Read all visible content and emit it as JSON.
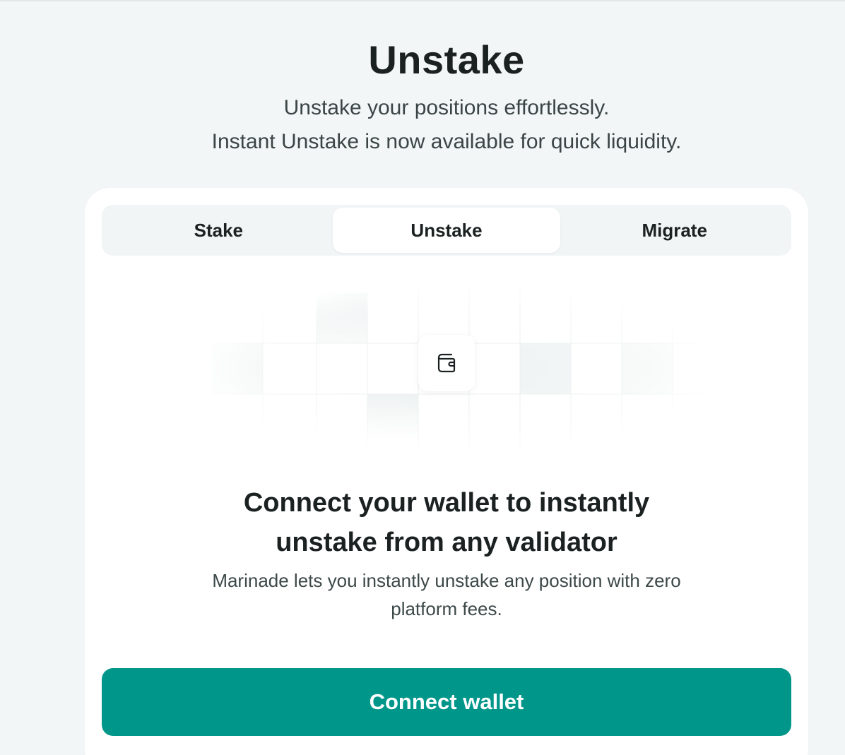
{
  "header": {
    "title": "Unstake",
    "subtitle_line1": "Unstake your positions effortlessly.",
    "subtitle_line2": "Instant Unstake is now available for quick liquidity."
  },
  "tabs": [
    {
      "label": "Stake",
      "active": false
    },
    {
      "label": "Unstake",
      "active": true
    },
    {
      "label": "Migrate",
      "active": false
    }
  ],
  "empty_state": {
    "icon": "wallet-icon",
    "headline_line1": "Connect your wallet to instantly",
    "headline_line2": "unstake from any validator",
    "description_line1": "Marinade lets you instantly unstake any position with zero",
    "description_line2": "platform fees."
  },
  "actions": {
    "connect_label": "Connect wallet"
  },
  "colors": {
    "accent": "#00968a",
    "page_background": "#f3f6f6",
    "card_background": "#ffffff"
  }
}
